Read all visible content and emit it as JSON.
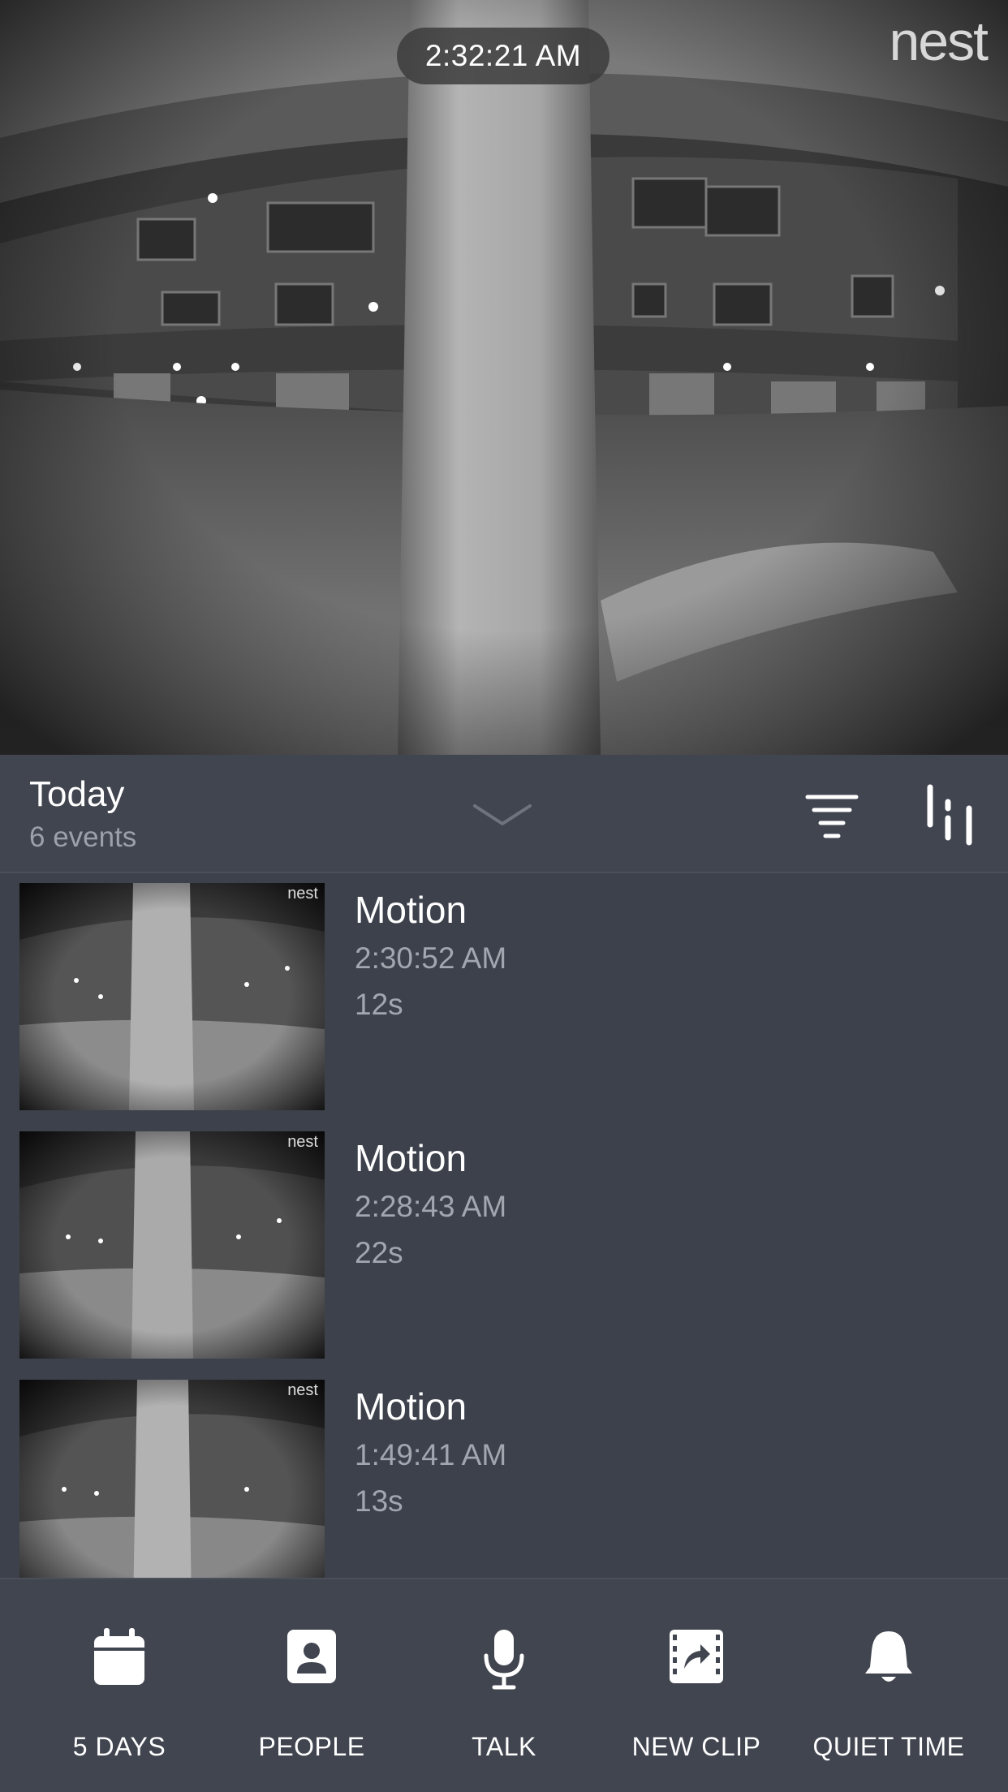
{
  "camera": {
    "timestamp": "2:32:21 AM",
    "brand": "nest"
  },
  "events_header": {
    "title": "Today",
    "count": "6 events"
  },
  "icons": {
    "collapse": "chevron-down-icon",
    "filter": "filter-icon",
    "timeline": "timeline-icon"
  },
  "events": [
    {
      "type": "Motion",
      "time": "2:30:52 AM",
      "duration": "12s",
      "thumb_brand": "nest"
    },
    {
      "type": "Motion",
      "time": "2:28:43 AM",
      "duration": "22s",
      "thumb_brand": "nest"
    },
    {
      "type": "Motion",
      "time": "1:49:41 AM",
      "duration": "13s",
      "thumb_brand": "nest"
    }
  ],
  "actions": [
    {
      "label": "5 DAYS",
      "icon": "calendar-icon"
    },
    {
      "label": "PEOPLE",
      "icon": "person-icon"
    },
    {
      "label": "TALK",
      "icon": "microphone-icon"
    },
    {
      "label": "NEW CLIP",
      "icon": "clip-share-icon"
    },
    {
      "label": "QUIET TIME",
      "icon": "bell-icon"
    }
  ],
  "colors": {
    "background": "#3d414b",
    "header": "#414550",
    "secondary_text": "#a2a6ae"
  }
}
